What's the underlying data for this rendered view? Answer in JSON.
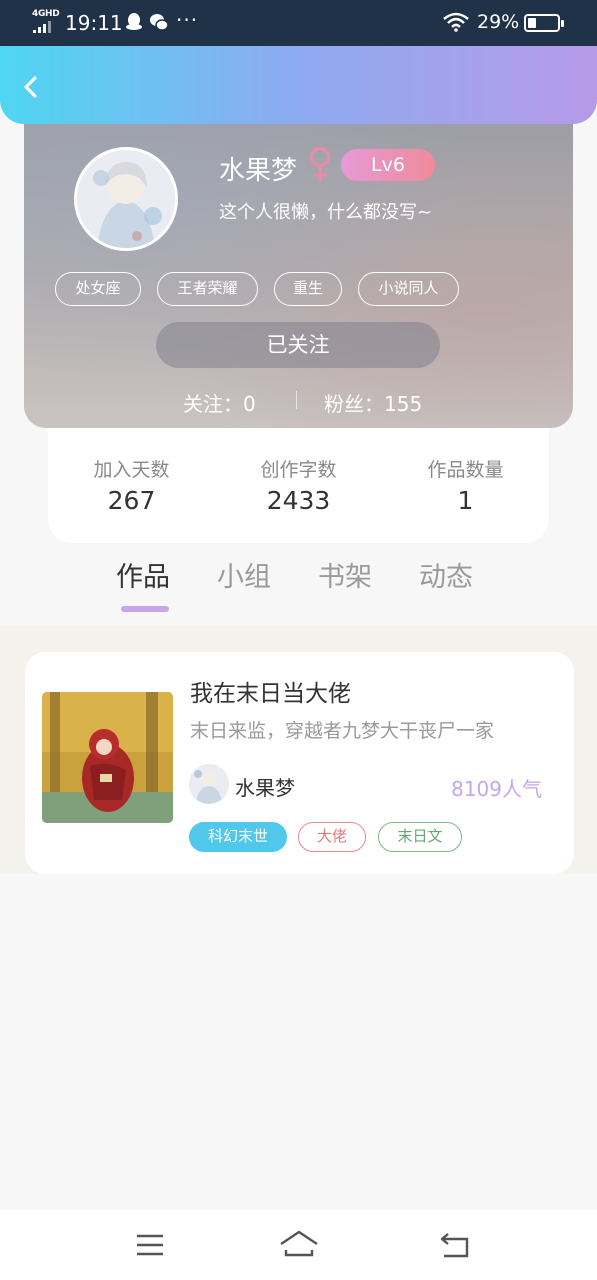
{
  "status_bar": {
    "network": "4GHD",
    "time": "19:11",
    "battery": "29%",
    "icons": [
      "signal-icon",
      "qq-icon",
      "wechat-icon",
      "more-dots-icon",
      "wifi-icon",
      "battery-icon"
    ]
  },
  "header": {
    "back_icon": "chevron-left-icon"
  },
  "profile": {
    "name": "水果梦",
    "gender_icon": "female-icon",
    "level": "Lv6",
    "bio": "这个人很懒，什么都没写~",
    "tags": [
      "处女座",
      "王者荣耀",
      "重生",
      "小说同人"
    ],
    "follow_button": "已关注",
    "following": "关注：0",
    "followers": "粉丝：155"
  },
  "stats": [
    {
      "label": "加入天数",
      "value": "267"
    },
    {
      "label": "创作字数",
      "value": "2433"
    },
    {
      "label": "作品数量",
      "value": "1"
    }
  ],
  "tabs": [
    {
      "label": "作品",
      "active": true
    },
    {
      "label": "小组",
      "active": false
    },
    {
      "label": "书架",
      "active": false
    },
    {
      "label": "动态",
      "active": false
    }
  ],
  "books": [
    {
      "title": "我在末日当大佬",
      "description": "末日来监，穿越者九梦大干丧尸一家",
      "author": "水果梦",
      "popularity": "8109人气",
      "tags": [
        "科幻末世",
        "大佬",
        "末日文"
      ]
    }
  ],
  "bottom_nav": [
    "menu-icon",
    "home-icon",
    "back-icon"
  ],
  "colors": {
    "accent_purple": "#c7a6e8",
    "header_gradient_start": "#4fd6f3",
    "header_gradient_end": "#b69ae8",
    "tag_blue": "#4fc8ec",
    "tag_red": "#e88a8a",
    "tag_green": "#7fb889"
  }
}
